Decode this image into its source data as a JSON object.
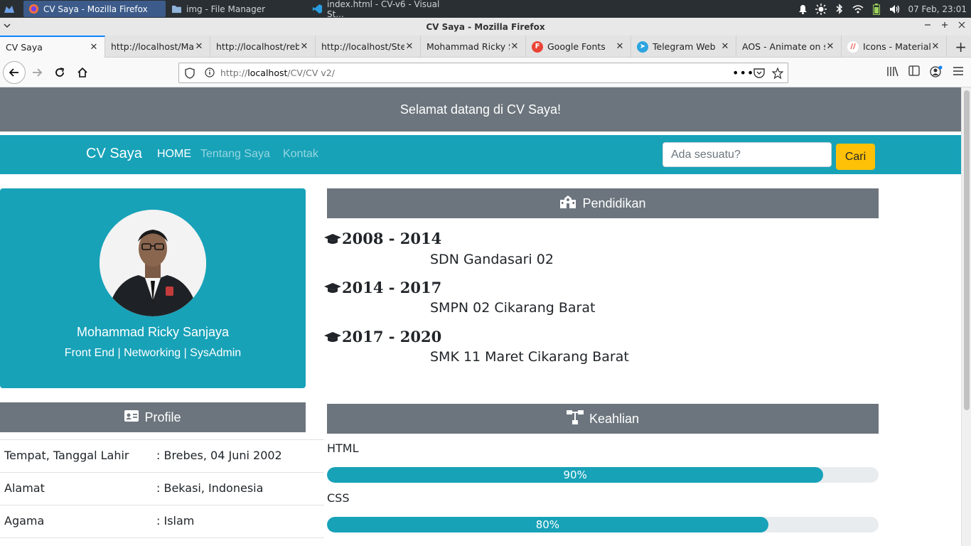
{
  "taskbar": {
    "tasks": [
      {
        "label": "CV Saya - Mozilla Firefox",
        "icon": "firefox-icon"
      },
      {
        "label": "img - File Manager",
        "icon": "folder-icon"
      },
      {
        "label": "index.html - CV-v6 - Visual St...",
        "icon": "vscode-icon"
      }
    ],
    "clock": "07 Feb, 23:01"
  },
  "window": {
    "title": "CV Saya - Mozilla Firefox"
  },
  "tabs": [
    {
      "label": "CV Saya",
      "active": true
    },
    {
      "label": "http://localhost/Ma"
    },
    {
      "label": "http://localhost/reb"
    },
    {
      "label": "http://localhost/Ste"
    },
    {
      "label": "Mohammad Ricky S"
    },
    {
      "label": "Google Fonts",
      "fav": "F",
      "fav_color": "#ea4335"
    },
    {
      "label": "Telegram Web",
      "fav": "➤",
      "fav_color": "#2ca5e0"
    },
    {
      "label": "AOS - Animate on sc"
    },
    {
      "label": "Icons - Material",
      "fav": "//",
      "fav_color": "#ffffff"
    }
  ],
  "url": {
    "prefix": "http://",
    "host": "localhost",
    "path": "/CV/CV v2/"
  },
  "page": {
    "welcome": "Selamat datang di CV Saya!",
    "nav": {
      "brand": "CV Saya",
      "links": [
        "HOME",
        "Tentang Saya",
        "Kontak"
      ],
      "search_placeholder": "Ada sesuatu?",
      "search_button": "Cari"
    },
    "profile": {
      "name": "Mohammad Ricky Sanjaya",
      "role": "Front End | Networking | SysAdmin"
    },
    "profile_section": {
      "title": "Profile",
      "rows": [
        {
          "key": "Tempat, Tanggal Lahir",
          "value": ": Brebes, 04 Juni 2002"
        },
        {
          "key": "Alamat",
          "value": ": Bekasi, Indonesia"
        },
        {
          "key": "Agama",
          "value": ": Islam"
        }
      ]
    },
    "education": {
      "title": "Pendidikan",
      "items": [
        {
          "years": "2008 - 2014",
          "school": "SDN Gandasari 02"
        },
        {
          "years": "2014 - 2017",
          "school": "SMPN 02 Cikarang Barat"
        },
        {
          "years": "2017 - 2020",
          "school": "SMK 11 Maret Cikarang Barat"
        }
      ]
    },
    "skills": {
      "title": "Keahlian",
      "items": [
        {
          "name": "HTML",
          "percent": 90,
          "label": "90%"
        },
        {
          "name": "CSS",
          "percent": 80,
          "label": "80%"
        }
      ]
    }
  },
  "colors": {
    "info": "#17a2b8",
    "secondary": "#6c757d",
    "warning": "#ffc107"
  }
}
